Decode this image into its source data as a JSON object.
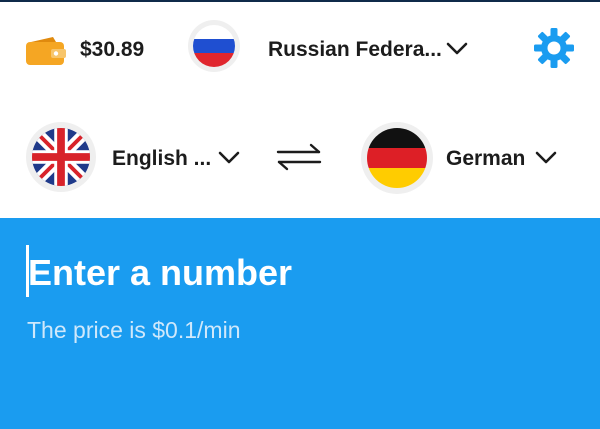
{
  "header": {
    "balance": "$30.89",
    "country": "Russian Federa...",
    "icons": {
      "wallet": "wallet-icon",
      "country_flag": "russia-flag-icon",
      "settings": "gear-icon"
    }
  },
  "languages": {
    "from": "English ...",
    "to": "German",
    "icons": {
      "from_flag": "uk-flag-icon",
      "to_flag": "germany-flag-icon",
      "swap": "swap-arrows-icon"
    }
  },
  "dialer": {
    "placeholder": "Enter a number",
    "price_text": "The price is $0.1/min"
  },
  "colors": {
    "accent": "#1a9cf0",
    "gear": "#1a9cf0",
    "wallet": "#f5a623",
    "text_dark": "#1c1c1c"
  }
}
